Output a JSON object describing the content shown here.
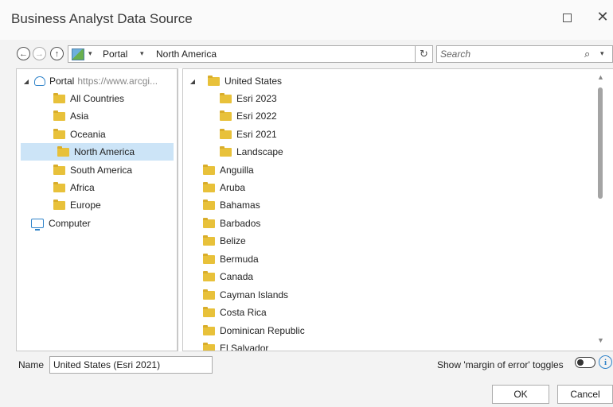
{
  "window": {
    "title": "Business Analyst Data Source",
    "maximize_glyph": "☐",
    "close_glyph": "✕"
  },
  "toolbar": {
    "back_icon": "arrow-left-circle",
    "forward_icon": "arrow-right-circle",
    "up_icon": "arrow-up-circle",
    "location": {
      "segments": [
        "Portal",
        "North America"
      ],
      "chevron": "▾"
    },
    "refresh_glyph": "↻",
    "search": {
      "placeholder": "Search",
      "icon_glyph": "⌕",
      "chevron": "▾"
    }
  },
  "tree": {
    "portal": {
      "label": "Portal",
      "url": "https://www.arcgi...",
      "expander": "◢"
    },
    "items": [
      {
        "label": "All Countries"
      },
      {
        "label": "Asia"
      },
      {
        "label": "Oceania"
      },
      {
        "label": "North America",
        "selected": true
      },
      {
        "label": "South America"
      },
      {
        "label": "Africa"
      },
      {
        "label": "Europe"
      }
    ],
    "computer": {
      "label": "Computer"
    }
  },
  "list": {
    "expanded_parent": {
      "label": "United States",
      "expander": "◢"
    },
    "children": [
      {
        "label": "Esri 2023"
      },
      {
        "label": "Esri 2022"
      },
      {
        "label": "Esri 2021"
      },
      {
        "label": "Landscape"
      }
    ],
    "items": [
      {
        "label": "Anguilla"
      },
      {
        "label": "Aruba"
      },
      {
        "label": "Bahamas"
      },
      {
        "label": "Barbados"
      },
      {
        "label": "Belize"
      },
      {
        "label": "Bermuda"
      },
      {
        "label": "Canada"
      },
      {
        "label": "Cayman Islands"
      },
      {
        "label": "Costa Rica"
      },
      {
        "label": "Dominican Republic"
      },
      {
        "label": "El Salvador"
      }
    ]
  },
  "footer": {
    "name_label": "Name",
    "name_value": "United States (Esri 2021)",
    "moe_label": "Show 'margin of error' toggles",
    "moe_toggle_on": false,
    "info_glyph": "i",
    "ok_label": "OK",
    "cancel_label": "Cancel"
  },
  "colors": {
    "selection": "#cce4f7",
    "folder": "#e8c13a",
    "accent": "#2f83c9"
  }
}
